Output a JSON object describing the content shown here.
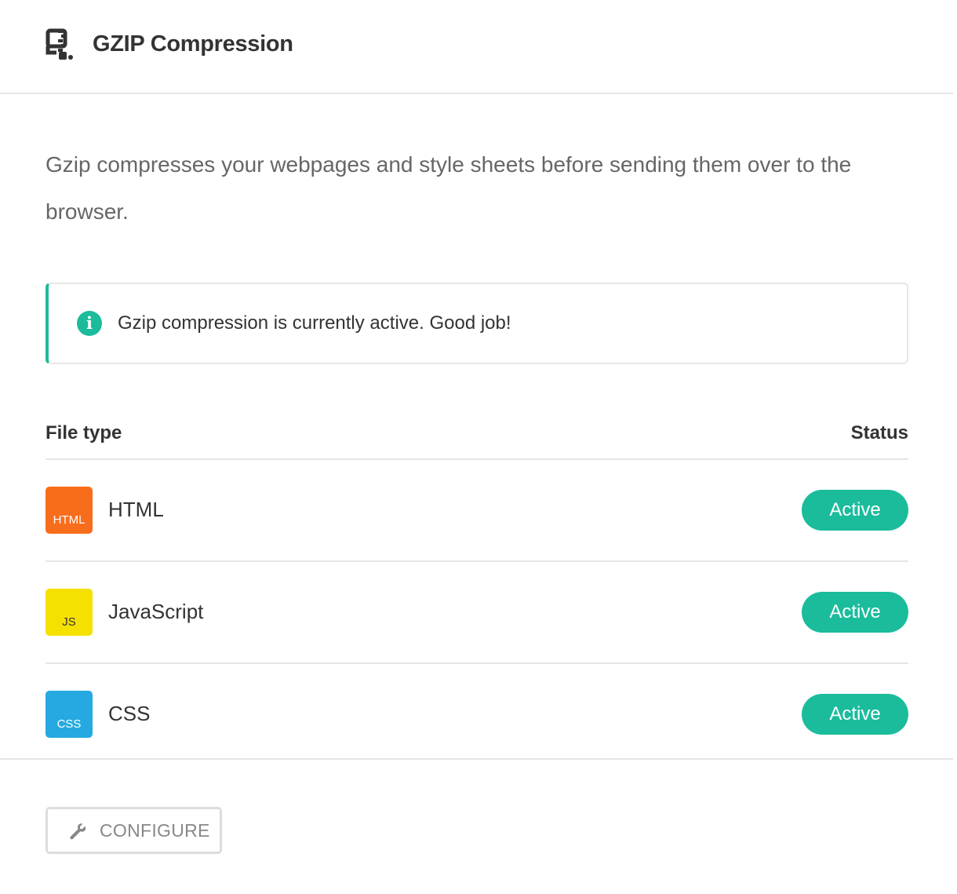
{
  "header": {
    "title": "GZIP Compression",
    "icon": "compress-icon"
  },
  "description": "Gzip compresses your webpages and style sheets before sending them over to the browser.",
  "notice": {
    "icon": "info-icon",
    "icon_glyph": "i",
    "text": "Gzip compression is currently active. Good job!",
    "accent_color": "#1abc9c"
  },
  "table": {
    "columns": [
      "File type",
      "Status"
    ],
    "rows": [
      {
        "badge": "HTML",
        "name": "HTML",
        "status": "Active",
        "badge_color": "#f86d1b"
      },
      {
        "badge": "JS",
        "name": "JavaScript",
        "status": "Active",
        "badge_color": "#f5e100"
      },
      {
        "badge": "CSS",
        "name": "CSS",
        "status": "Active",
        "badge_color": "#25a9e0"
      }
    ]
  },
  "footer": {
    "configure_label": "CONFIGURE",
    "configure_icon": "wrench-icon"
  },
  "colors": {
    "status_active": "#1abc9c",
    "border": "#e6e6e6"
  }
}
